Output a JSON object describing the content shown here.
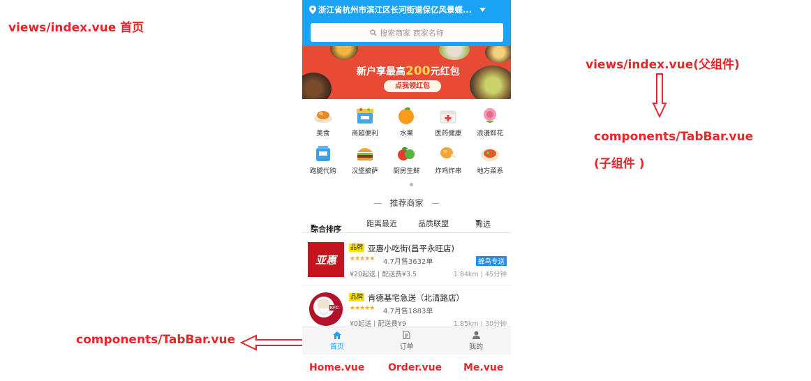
{
  "annotations": {
    "index_home": "views/index.vue 首页",
    "parent": "views/index.vue(父组件)",
    "tabbar_right": "components/TabBar.vue",
    "child": "(子组件 )",
    "tabbar_left": "components/TabBar.vue",
    "file_home": "Home.vue",
    "file_order": "Order.vue",
    "file_me": "Me.vue"
  },
  "colors": {
    "accent": "#1aa3f4",
    "annotation": "#e8262a",
    "banner": "#e94a35",
    "brand_tag": "#ffe300"
  },
  "header": {
    "address": "浙江省杭州市滨江区长河街道保亿风景蝶...",
    "search_placeholder": "搜索商家 商家名称"
  },
  "banner": {
    "title_prefix": "新户享最高",
    "title_amount": "200",
    "title_suffix": "元红包",
    "button": "点我领红包"
  },
  "categories": [
    {
      "label": "美食",
      "icon": "food-icon"
    },
    {
      "label": "商超便利",
      "icon": "shop-icon"
    },
    {
      "label": "水果",
      "icon": "orange-icon"
    },
    {
      "label": "医药健康",
      "icon": "medicine-icon"
    },
    {
      "label": "浪漫鲜花",
      "icon": "flower-icon"
    },
    {
      "label": "跑腿代购",
      "icon": "errand-icon"
    },
    {
      "label": "汉堡披萨",
      "icon": "burger-icon"
    },
    {
      "label": "厨房生鲜",
      "icon": "vegetable-icon"
    },
    {
      "label": "炸鸡炸串",
      "icon": "fried-chicken-icon"
    },
    {
      "label": "地方菜系",
      "icon": "dish-icon"
    }
  ],
  "recommend_title": "推荐商家",
  "sort": {
    "comprehensive": "综合排序",
    "distance": "距离最近",
    "quality": "品质联盟",
    "filter": "筛选"
  },
  "shops": [
    {
      "brand": "品牌",
      "name": "亚惠小吃街(昌平永旺店)",
      "logo_text": "亚惠",
      "stars": "★★★★★",
      "rating_sales": "4.7月售3632单",
      "tag": "蜂鸟专送",
      "delivery": "¥20起送 | 配送费¥3.5",
      "distance": "1.84km | 45分钟"
    },
    {
      "brand": "品牌",
      "name": "肯德基宅急送（北清路店）",
      "logo_text": "KFC",
      "stars": "★★★★★",
      "rating_sales": "4.7月售1883单",
      "delivery": "¥0起送 | 配送费¥9",
      "distance": "1.85km | 30分钟"
    }
  ],
  "tabs": [
    {
      "label": "首页",
      "icon": "home-icon",
      "active": true
    },
    {
      "label": "订单",
      "icon": "order-icon",
      "active": false
    },
    {
      "label": "我的",
      "icon": "user-icon",
      "active": false
    }
  ]
}
